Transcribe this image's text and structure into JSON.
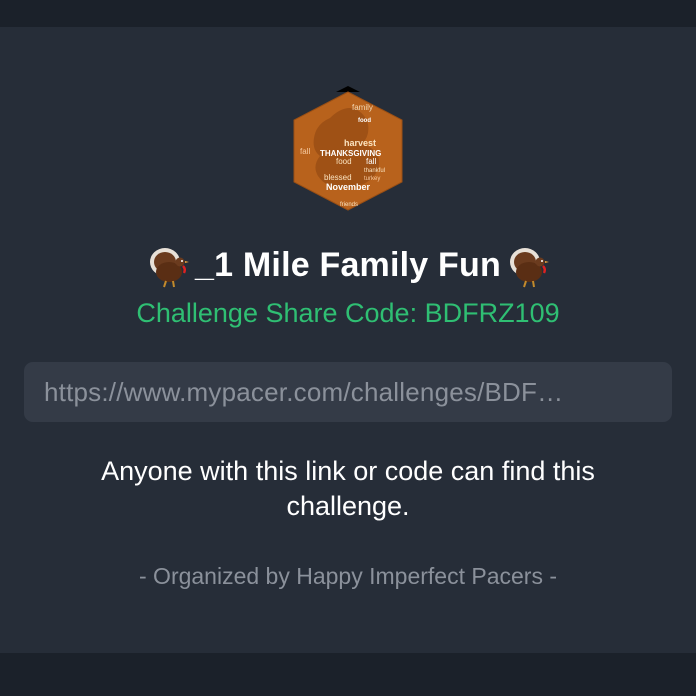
{
  "challenge": {
    "badge_words": [
      "family",
      "food",
      "harvest",
      "THANKSGIVING",
      "fall",
      "food",
      "fall",
      "blessed",
      "turkey",
      "November",
      "thankful",
      "friends"
    ],
    "title": "_1 Mile Family Fun",
    "title_emoji_icon": "turkey-icon",
    "share_code_text": "Challenge Share Code: BDFRZ109",
    "share_url": "https://www.mypacer.com/challenges/BDF…",
    "notice_text": "Anyone with this link or code can find this challenge.",
    "organizer_text": "- Organized by Happy Imperfect Pacers -"
  },
  "colors": {
    "background": "#1b212a",
    "card": "#262d38",
    "accent_green": "#2fbf73",
    "url_box": "#343b47",
    "muted_text": "#8b919b",
    "badge_orange": "#b8621c"
  }
}
